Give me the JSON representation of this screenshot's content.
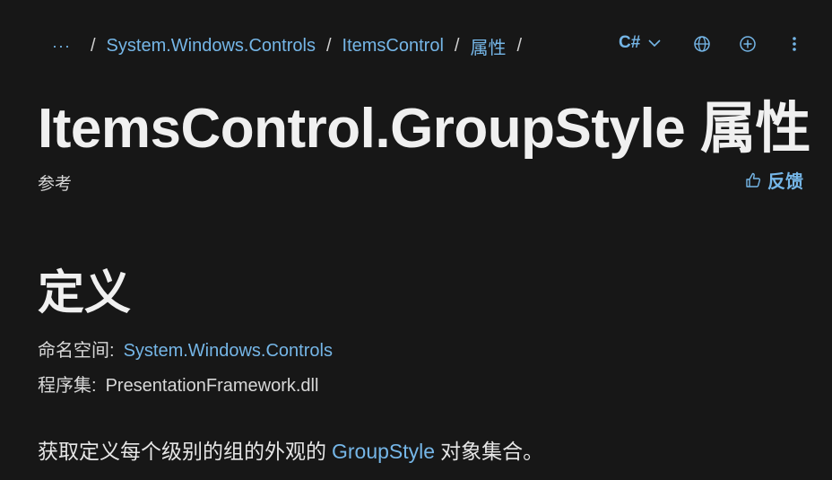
{
  "breadcrumb": {
    "more": "···",
    "items": [
      "System.Windows.Controls",
      "ItemsControl",
      "属性"
    ],
    "separator": "/"
  },
  "language_selector": {
    "label": "C#"
  },
  "icons": {
    "language": "globe-icon",
    "add": "add-circle-icon",
    "more": "more-vertical-icon",
    "feedback": "thumbs-up-icon"
  },
  "page_title": "ItemsControl.GroupStyle 属性",
  "reference_label": "参考",
  "feedback": {
    "label": "反馈"
  },
  "definition": {
    "heading": "定义",
    "namespace_label": "命名空间:",
    "namespace_value": "System.Windows.Controls",
    "assembly_label": "程序集:",
    "assembly_value": "PresentationFramework.dll"
  },
  "summary": {
    "before": "获取定义每个级别的组的外观的",
    "link": "GroupStyle",
    "after": "对象集合。"
  },
  "colors": {
    "background": "#171717",
    "link": "#75b6e7",
    "text": "#e6e6e6"
  }
}
